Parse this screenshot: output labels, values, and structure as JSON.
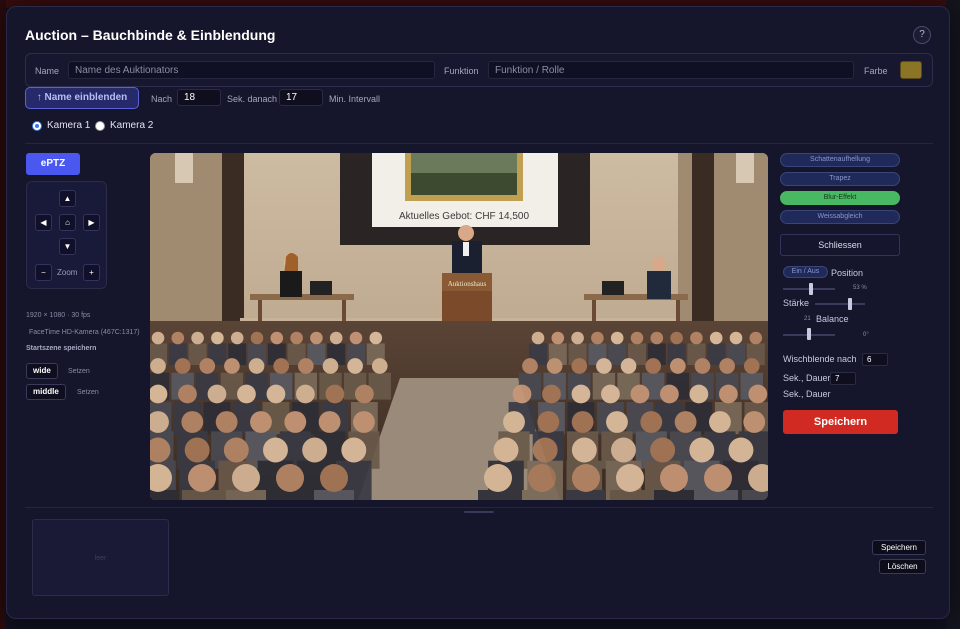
{
  "dialog": {
    "title": "Auction – Bauchbinde & Einblendung",
    "help_label": "?"
  },
  "name_row": {
    "name_label": "Name",
    "name_placeholder": "Name des Auktionators",
    "name_value": "",
    "function_label": "Funktion",
    "function_placeholder": "Funktion / Rolle",
    "function_value": "",
    "color_label": "Farbe",
    "color_value": "#8c7426"
  },
  "timing": {
    "show_button": "↑ Name einblenden",
    "after_label": "Nach",
    "after_value": "18",
    "after_unit": "Sek. danach",
    "interval_value": "17",
    "interval_unit": "Min. Intervall"
  },
  "cameras": {
    "options": [
      "Kamera 1",
      "Kamera 2"
    ],
    "selected": "Kamera 1"
  },
  "eptz": {
    "button": "ePTZ",
    "zoom_label": "Zoom",
    "zoom_out": "−",
    "zoom_in": "+",
    "resolution": "1920 × 1080 · 30 fps",
    "device": "FaceTime HD-Kamera (467C:1317)",
    "save_scene": "Startszene speichern",
    "scenes": [
      {
        "name": "wide",
        "action": "Setzen"
      },
      {
        "name": "middle",
        "action": "Setzen"
      }
    ]
  },
  "preview": {
    "screen_text": "Aktuelles Gebot: CHF 14,500",
    "podium_text": "Auktionshaus"
  },
  "effects": {
    "pills": [
      {
        "label": "Schattenaufhellung",
        "active": false
      },
      {
        "label": "Trapez",
        "active": false
      },
      {
        "label": "Blur-Effekt",
        "active": true
      },
      {
        "label": "Weissabgleich",
        "active": false
      }
    ],
    "close_button": "Schliessen",
    "toggle": "Ein / Aus",
    "position_label": "Position",
    "position_value": "53 %",
    "position_fraction": 0.53,
    "strength_label": "Stärke",
    "strength_value": "21",
    "strength_fraction": 0.7,
    "balance_label": "Balance",
    "balance_value": "0°",
    "balance_fraction": 0.5,
    "wipe_label": "Wischblende nach",
    "wipe_value": "6",
    "wipe_unit": "Sek., Dauer",
    "duration_value": "7",
    "duration_unit": "Sek., Dauer",
    "save_button": "Speichern"
  },
  "bottom": {
    "thumb_label": "leer",
    "save_button": "Speichern",
    "delete_button": "Löschen"
  }
}
